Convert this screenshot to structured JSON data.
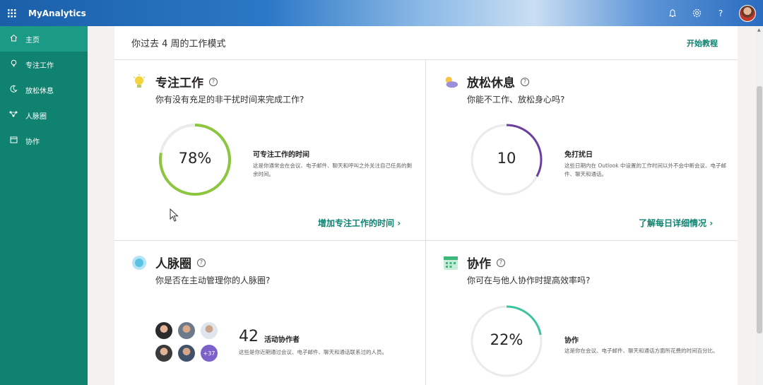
{
  "app": {
    "title": "MyAnalytics"
  },
  "topbar": {
    "icons": [
      "waffle-icon",
      "bell-icon",
      "gear-icon",
      "help-icon",
      "avatar"
    ],
    "help_glyph": "?"
  },
  "sidebar": {
    "items": [
      {
        "label": "主页",
        "icon": "home-icon",
        "active": true
      },
      {
        "label": "专注工作",
        "icon": "bulb-icon",
        "active": false
      },
      {
        "label": "放松休息",
        "icon": "moon-icon",
        "active": false
      },
      {
        "label": "人脉圈",
        "icon": "network-icon",
        "active": false
      },
      {
        "label": "协作",
        "icon": "calendar-icon",
        "active": false
      }
    ]
  },
  "main": {
    "header": {
      "title": "你过去 4 周的工作模式",
      "link": "开始教程"
    },
    "cards": {
      "focus": {
        "title": "专注工作",
        "question": "你有没有充足的非干扰时间来完成工作?",
        "ring_value_text": "78%",
        "ring_fraction": 0.78,
        "metric_title": "可专注工作的时间",
        "metric_desc": "这是你通常会在会议、电子邮件、聊天和呼叫之外关注自己任务的剩余时间。",
        "link": "增加专注工作的时间"
      },
      "wellbeing": {
        "title": "放松休息",
        "question": "你能不工作、放松身心吗?",
        "ring_value_text": "10",
        "ring_fraction": 0.33,
        "metric_title": "免打扰日",
        "metric_desc": "这些日期内在 Outlook 中设置的工作时间以外不会中断会议、电子邮件、聊天和通话。",
        "link": "了解每日详细情况"
      },
      "network": {
        "title": "人脉圈",
        "question": "你是否在主动管理你的人脉圈?",
        "count": "42",
        "metric_title": "活动协作者",
        "metric_desc": "这些是你近期通过会议、电子邮件、聊天和通话联系过的人员。",
        "more_badge": "+37"
      },
      "collaboration": {
        "title": "协作",
        "question": "你可在与他人协作时提高效率吗?",
        "ring_value_text": "22%",
        "ring_fraction": 0.22,
        "metric_title": "协作",
        "metric_desc": "这是你在会议、电子邮件、聊天和通话方面所花费的时间百分比。"
      }
    }
  },
  "colors": {
    "accent": "#0f8270",
    "focus_ring": "#8cc63f",
    "focus_ring_start": "#0f8270",
    "wellbeing_ring": "#6b3fa0",
    "collab_ring": "#3cc4a0",
    "track": "#ebebeb"
  }
}
